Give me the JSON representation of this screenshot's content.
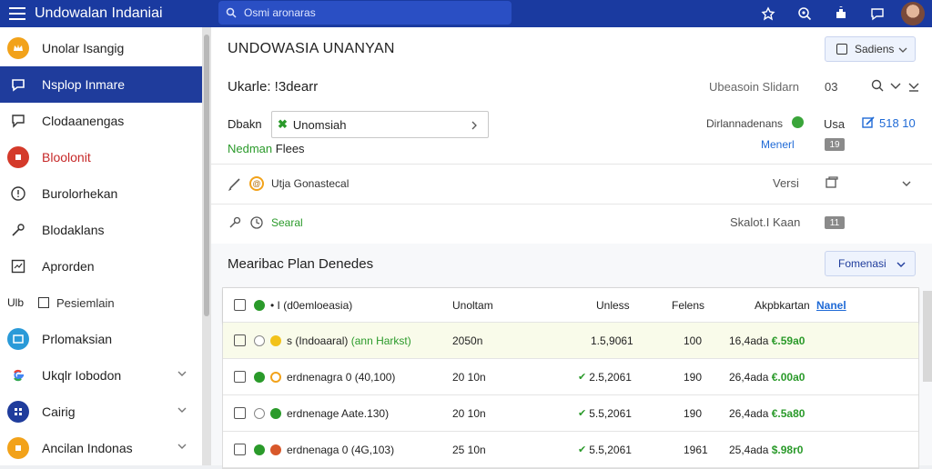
{
  "topbar": {
    "title": "Undowalan Indaniai",
    "search_placeholder": "Osmi aronaras",
    "icons": [
      "bookmark-icon",
      "search-circle-icon",
      "puzzle-icon",
      "chat-icon"
    ]
  },
  "sidebar": {
    "items": [
      {
        "label": "Unolar Isangig",
        "icon": "crown-icon",
        "color": "#f2a21a",
        "active": false
      },
      {
        "label": "Nsplop Inmare",
        "icon": "speech-icon",
        "color": "#1f3c9c",
        "active": true
      },
      {
        "label": "Clodaanengas",
        "icon": "chat-icon",
        "color": "none",
        "active": false
      },
      {
        "label": "Bloolonit",
        "icon": "record-icon",
        "color": "#d43a2a",
        "active": false
      },
      {
        "label": "Burolorhekan",
        "icon": "info-icon",
        "color": "none",
        "active": false
      },
      {
        "label": "Blodaklans",
        "icon": "key-icon",
        "color": "none",
        "active": false
      },
      {
        "label": "Aprorden",
        "icon": "chart-icon",
        "color": "none",
        "active": false
      },
      {
        "label": "Pesiemlain",
        "icon": "square-icon",
        "color": "none",
        "active": false
      },
      {
        "label": "Prlomaksian",
        "icon": "window-icon",
        "color": "#2a9ad8",
        "active": false
      },
      {
        "label": "Ukqlr Iobodon",
        "icon": "google-icon",
        "color": "none",
        "active": false
      },
      {
        "label": "Cairig",
        "icon": "grid-icon",
        "color": "#1f3c9c",
        "active": false
      },
      {
        "label": "Ancilan Indonas",
        "icon": "download-icon",
        "color": "#f2a21a",
        "active": false
      }
    ],
    "prefix_text": "Ulb"
  },
  "main": {
    "page_title": "UNDOWASIA UNANYAN",
    "select_label": "Sadiens",
    "row1": {
      "label": "Ukarle: !3dearr",
      "right_text": "Ubeasoin Slidarn",
      "right_num": "03"
    },
    "filter": {
      "label": "Dbakn",
      "value": "Unomsiah",
      "value_mark": "✖",
      "right_label": "Dirlannadenans",
      "right_value": "Usa",
      "right_link": "518 10"
    },
    "note": {
      "label_green": "Nedman",
      "label_rest": "Flees",
      "right_link": "Menerl",
      "badge": "19"
    },
    "option1": {
      "label": "Utja Gonastecal",
      "right": "Versi"
    },
    "option2": {
      "label": "Searal",
      "right": "Skalot.I Kaan",
      "badge": "11"
    },
    "plan_title": "Mearibac Plan Denedes",
    "format_label": "Fomenasi"
  },
  "table": {
    "headers": [
      "• I (d0emloeasia)",
      "Unoltam",
      "Unless",
      "Felens",
      "Akpbkartan",
      "Nanel"
    ],
    "rows": [
      {
        "dot_color": "#f2c21a",
        "dot_kind": "filled",
        "prefix": "s (Indoaaral)",
        "suffix": "(ann Harkst)",
        "c1": "2050n",
        "c2": "1.5,9061",
        "c2_tick": false,
        "c3": "100",
        "c4": "16,4ada",
        "c5": "€.59a0",
        "highlight": true
      },
      {
        "dot_color": "#f2a21a",
        "dot_kind": "ring",
        "prefix": "erdnenagra 0 (40,100)",
        "suffix": "",
        "c1": "20 10n",
        "c2": "2.5,2061",
        "c2_tick": true,
        "c3": "190",
        "c4": "26,4ada",
        "c5": "€.00a0",
        "highlight": false
      },
      {
        "dot_color": "#2a9a2a",
        "dot_kind": "filled",
        "prefix": "erdnenage Aate.130)",
        "suffix": "",
        "c1": "20 10n",
        "c2": "5.5,2061",
        "c2_tick": true,
        "c3": "190",
        "c4": "26,4ada",
        "c5": "€.5a80",
        "highlight": false
      },
      {
        "dot_color": "#d8582a",
        "dot_kind": "filled",
        "prefix": "erdnenaga 0 (4G,103)",
        "suffix": "",
        "c1": "25 10n",
        "c2": "5.5,2061",
        "c2_tick": true,
        "c3": "1961",
        "c4": "25,4ada",
        "c5": "$.98r0",
        "highlight": false
      }
    ]
  }
}
